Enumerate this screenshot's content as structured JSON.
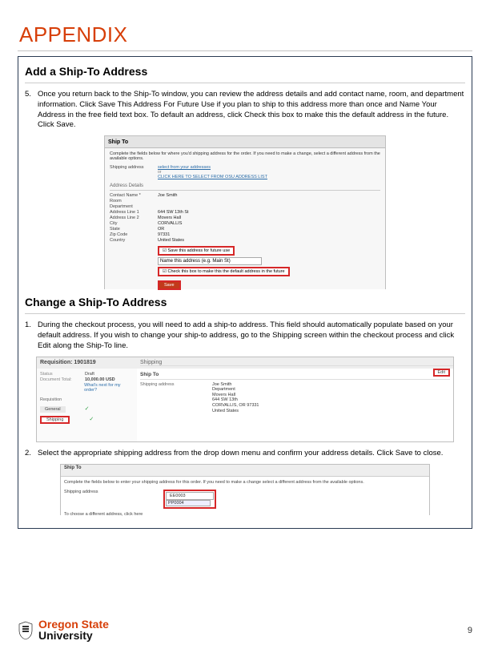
{
  "page_title": "APPENDIX",
  "page_number": "9",
  "section1": {
    "heading": "Add a Ship-To Address",
    "step_num": "5.",
    "step_text": "Once you return back to the Ship-To window, you can review the address details and add contact name, room, and department information. Click Save This Address For Future Use if you plan to ship to this address more than once and Name Your Address in the free field text box. To default an address, click Check this box to make this the default address in the future. Click Save."
  },
  "shot1": {
    "title": "Ship To",
    "instruction": "Complete the fields below for where you'd shipping address for the order. If you need to make a change, select a different address from the available options.",
    "shipping_label": "Shipping address",
    "select_link": "select from your addresses",
    "click_link": "CLICK HERE TO SELECT FROM OSU ADDRESS LIST",
    "details_label": "Address Details",
    "contact_label": "Contact Name *",
    "contact_val": "Joe Smith",
    "room_label": "Room",
    "dept_label": "Department",
    "addr1_label": "Address Line 1",
    "addr1_val": "644 SW 13th St",
    "addr2_label": "Address Line 2",
    "addr2_val": "Movers Hall",
    "city_label": "City",
    "city_val": "CORVALLIS",
    "state_label": "State",
    "state_val": "OR",
    "zip_label": "Zip Code",
    "zip_val": "97331",
    "country_label": "Country",
    "country_val": "United States",
    "save_future": "Save this address for future use",
    "name_hint": "Name this address (e.g. Main St)",
    "default_cb": "Check this box to make this the default address in the future",
    "save_btn": "Save"
  },
  "section2": {
    "heading": "Change a Ship-To Address",
    "step1_num": "1.",
    "step1_text": "During the checkout process, you will need to add a ship-to address. This field should automatically populate based on your default address. If you wish to change your ship-to address, go to the Shipping screen within the checkout process and click Edit along the Ship-To line.",
    "step2_num": "2.",
    "step2_text": "Select the appropriate shipping address from the drop down menu and confirm your address details. Click Save to close."
  },
  "shot2": {
    "req": "Requisition: 1901819",
    "tab": "Shipping",
    "status": "Status",
    "draft": "Draft",
    "doctotal_l": "Document Total:",
    "doctotal_v": "10,000.00 USD",
    "what_next": "What's next for my order?",
    "reqs": "Requisition",
    "general": "General",
    "shipping": "Shipping",
    "shipto": "Ship To",
    "shipaddr": "Shipping address",
    "edit": "Edit",
    "name": "Joe Smith",
    "dept": "Department",
    "a1": "Movers Hall",
    "a2": "644 SW 13th",
    "csz": "CORVALLIS, OR 97331",
    "country": "United States"
  },
  "shot3": {
    "title": "Ship To",
    "instruction": "Complete the fields below to enter your shipping address for this order. If you need to make a change select a different address from the available options.",
    "shipaddr": "Shipping address",
    "opt1": "EE0003",
    "opt2": "PP0004",
    "note": "To choose a different address, click here"
  },
  "logo": {
    "os": "Oregon State",
    "uni": "University"
  }
}
